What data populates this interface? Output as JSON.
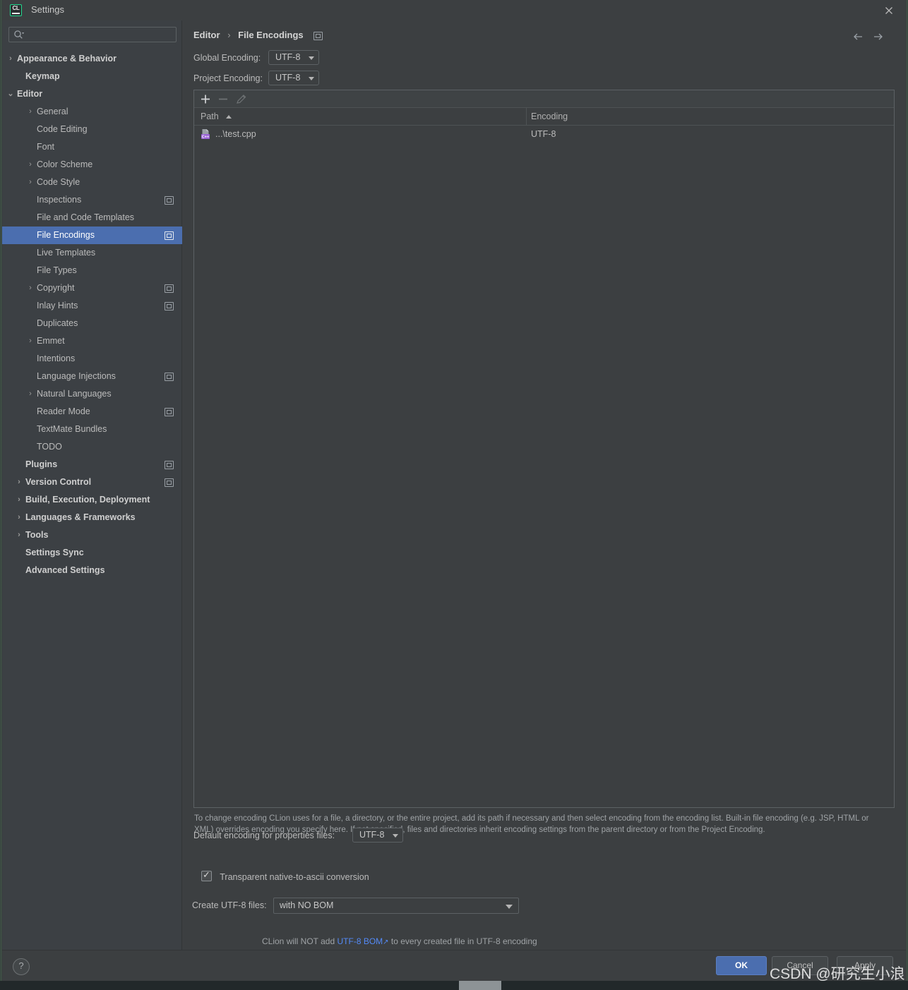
{
  "window": {
    "title": "Settings",
    "logo_text": "CL",
    "close_icon": "close-icon"
  },
  "search": {
    "value": "",
    "placeholder": ""
  },
  "sidebar": {
    "items": [
      {
        "label": "Appearance & Behavior",
        "indent": 21,
        "arrow": "›",
        "bold": true,
        "scope": false,
        "selected": false
      },
      {
        "label": "Keymap",
        "indent": 33,
        "arrow": "",
        "bold": true,
        "scope": false,
        "selected": false
      },
      {
        "label": "Editor",
        "indent": 21,
        "arrow": "⌄",
        "bold": true,
        "scope": false,
        "selected": false
      },
      {
        "label": "General",
        "indent": 49,
        "arrow": "›",
        "bold": false,
        "scope": false,
        "selected": false
      },
      {
        "label": "Code Editing",
        "indent": 49,
        "arrow": "",
        "bold": false,
        "scope": false,
        "selected": false
      },
      {
        "label": "Font",
        "indent": 49,
        "arrow": "",
        "bold": false,
        "scope": false,
        "selected": false
      },
      {
        "label": "Color Scheme",
        "indent": 49,
        "arrow": "›",
        "bold": false,
        "scope": false,
        "selected": false
      },
      {
        "label": "Code Style",
        "indent": 49,
        "arrow": "›",
        "bold": false,
        "scope": false,
        "selected": false
      },
      {
        "label": "Inspections",
        "indent": 49,
        "arrow": "",
        "bold": false,
        "scope": true,
        "selected": false
      },
      {
        "label": "File and Code Templates",
        "indent": 49,
        "arrow": "",
        "bold": false,
        "scope": false,
        "selected": false
      },
      {
        "label": "File Encodings",
        "indent": 49,
        "arrow": "",
        "bold": false,
        "scope": true,
        "selected": true
      },
      {
        "label": "Live Templates",
        "indent": 49,
        "arrow": "",
        "bold": false,
        "scope": false,
        "selected": false
      },
      {
        "label": "File Types",
        "indent": 49,
        "arrow": "",
        "bold": false,
        "scope": false,
        "selected": false
      },
      {
        "label": "Copyright",
        "indent": 49,
        "arrow": "›",
        "bold": false,
        "scope": true,
        "selected": false
      },
      {
        "label": "Inlay Hints",
        "indent": 49,
        "arrow": "",
        "bold": false,
        "scope": true,
        "selected": false
      },
      {
        "label": "Duplicates",
        "indent": 49,
        "arrow": "",
        "bold": false,
        "scope": false,
        "selected": false
      },
      {
        "label": "Emmet",
        "indent": 49,
        "arrow": "›",
        "bold": false,
        "scope": false,
        "selected": false
      },
      {
        "label": "Intentions",
        "indent": 49,
        "arrow": "",
        "bold": false,
        "scope": false,
        "selected": false
      },
      {
        "label": "Language Injections",
        "indent": 49,
        "arrow": "",
        "bold": false,
        "scope": true,
        "selected": false
      },
      {
        "label": "Natural Languages",
        "indent": 49,
        "arrow": "›",
        "bold": false,
        "scope": false,
        "selected": false
      },
      {
        "label": "Reader Mode",
        "indent": 49,
        "arrow": "",
        "bold": false,
        "scope": true,
        "selected": false
      },
      {
        "label": "TextMate Bundles",
        "indent": 49,
        "arrow": "",
        "bold": false,
        "scope": false,
        "selected": false
      },
      {
        "label": "TODO",
        "indent": 49,
        "arrow": "",
        "bold": false,
        "scope": false,
        "selected": false
      },
      {
        "label": "Plugins",
        "indent": 33,
        "arrow": "",
        "bold": true,
        "scope": true,
        "selected": false
      },
      {
        "label": "Version Control",
        "indent": 33,
        "arrow": "›",
        "bold": true,
        "scope": true,
        "selected": false
      },
      {
        "label": "Build, Execution, Deployment",
        "indent": 33,
        "arrow": "›",
        "bold": true,
        "scope": false,
        "selected": false
      },
      {
        "label": "Languages & Frameworks",
        "indent": 33,
        "arrow": "›",
        "bold": true,
        "scope": false,
        "selected": false
      },
      {
        "label": "Tools",
        "indent": 33,
        "arrow": "›",
        "bold": true,
        "scope": false,
        "selected": false
      },
      {
        "label": "Settings Sync",
        "indent": 33,
        "arrow": "",
        "bold": true,
        "scope": false,
        "selected": false
      },
      {
        "label": "Advanced Settings",
        "indent": 33,
        "arrow": "",
        "bold": true,
        "scope": false,
        "selected": false
      }
    ]
  },
  "main": {
    "breadcrumb_parent": "Editor",
    "breadcrumb_sep": "›",
    "breadcrumb_current": "File Encodings",
    "global_encoding_label": "Global Encoding:",
    "global_encoding_value": "UTF-8",
    "project_encoding_label": "Project Encoding:",
    "project_encoding_value": "UTF-8",
    "toolbar": {
      "add": "+",
      "remove": "–",
      "edit": "pencil"
    },
    "table": {
      "columns": [
        "Path",
        "Encoding"
      ],
      "sort_column": "Path",
      "sort_direction": "asc",
      "rows": [
        {
          "path": "...\\test.cpp",
          "encoding": "UTF-8",
          "icon": "cpp-file-icon"
        }
      ]
    },
    "description": "To change encoding CLion uses for a file, a directory, or the entire project, add its path if necessary and then select encoding from the encoding list. Built-in file encoding (e.g. JSP, HTML or XML) overrides encoding you specify here. If not specified, files and directories inherit encoding settings from the parent directory or from the Project Encoding.",
    "properties_label": "Default encoding for properties files:",
    "properties_value": "UTF-8",
    "native_to_ascii_label": "Transparent native-to-ascii conversion",
    "native_to_ascii_checked": true,
    "create_utf8_label": "Create UTF-8 files:",
    "create_utf8_value": "with NO BOM",
    "hint_before": "CLion will NOT add ",
    "hint_link": "UTF-8 BOM",
    "hint_after": " to every created file in UTF-8 encoding"
  },
  "footer": {
    "help": "?",
    "ok": "OK",
    "cancel": "Cancel",
    "apply": "Apply"
  },
  "watermark": "CSDN @研究生小浪",
  "colors": {
    "window_bg": "#3c3f41",
    "sidebar_bg": "#3c4044",
    "selection": "#4b6eaf",
    "accent_link": "#548af7",
    "logo_green": "#22d88f",
    "text": "#bbbbbb"
  }
}
